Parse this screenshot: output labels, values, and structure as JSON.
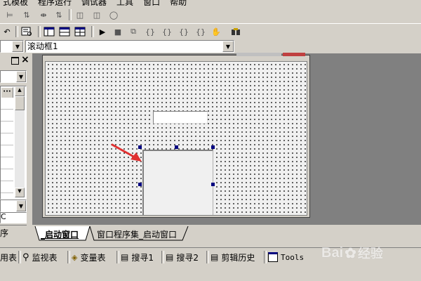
{
  "menu": {
    "items_visible": [
      "式模板",
      "程序运行",
      "调试器",
      "工具",
      "窗口",
      "帮助"
    ]
  },
  "dropdowns": {
    "control_selector": "滚动框1"
  },
  "properties_panel": {
    "close_glyph": "×",
    "bottom_label_1": "C",
    "bottom_tab_label": "序"
  },
  "editor_tabs": {
    "active": "_启动窗口",
    "inactive": "窗口程序集_启动窗口"
  },
  "bottom_tabs": [
    {
      "label": "用表",
      "icon": "table-icon"
    },
    {
      "label": "监视表",
      "icon": "magnifier-icon"
    },
    {
      "label": "变量表",
      "icon": "variable-icon"
    },
    {
      "label": "搜寻1",
      "icon": "search-list-icon"
    },
    {
      "label": "搜寻2",
      "icon": "search-list-icon"
    },
    {
      "label": "剪辑历史",
      "icon": "clipboard-icon"
    },
    {
      "label": "Tools",
      "icon": "window-icon"
    }
  ],
  "watermark": {
    "brand": "Bai",
    "brand_cn": "经验"
  },
  "colors": {
    "face": "#d4d0c8",
    "workspace": "#808080",
    "form_bg": "#f0f0f0",
    "handle": "#000080",
    "arrow": "#e03030"
  }
}
